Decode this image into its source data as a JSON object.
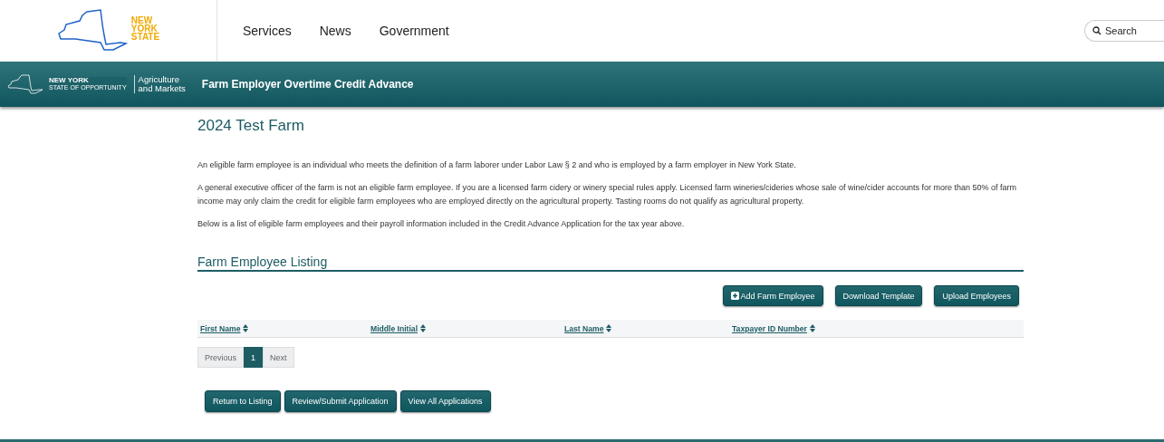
{
  "header": {
    "logo_text": [
      "NEW",
      "YORK",
      "STATE"
    ],
    "nav": [
      "Services",
      "News",
      "Government"
    ],
    "search": {
      "placeholder": "Search"
    }
  },
  "banner": {
    "agency_mark": [
      "NEW YORK",
      "STATE OF OPPORTUNITY"
    ],
    "agency": [
      "Agriculture",
      "and Markets"
    ],
    "title": "Farm Employer Overtime Credit Advance"
  },
  "page_title": "2024 Test Farm",
  "paragraphs": [
    "An eligible farm employee is an individual who meets the definition of a farm laborer under Labor Law § 2 and who is employed by a farm employer in New York State.",
    "A general executive officer of the farm is not an eligible farm employee. If you are a licensed farm cidery or winery special rules apply. Licensed farm wineries/cideries whose sale of wine/cider accounts for more than 50% of farm income may only claim the credit for eligible farm employees who are employed directly on the agricultural property. Tasting rooms do not qualify as agricultural property.",
    "Below is a list of eligible farm employees and their payroll information included in the Credit Advance Application for the tax year above."
  ],
  "listing": {
    "title": "Farm Employee Listing",
    "actions": [
      {
        "label": "Add Farm Employee",
        "kind": "add"
      },
      {
        "label": "Download Template",
        "kind": "plain"
      },
      {
        "label": "Upload Employees",
        "kind": "plain"
      }
    ],
    "columns": [
      "First Name",
      "Middle Initial",
      "Last Name",
      "Taxpayer ID Number"
    ],
    "pagination": [
      {
        "label": "Previous",
        "selected": false
      },
      {
        "label": "1",
        "selected": true
      },
      {
        "label": "Next",
        "selected": false
      }
    ]
  },
  "footer_buttons": [
    "Return to Listing",
    "Review/Submit Application",
    "View All Applications"
  ]
}
